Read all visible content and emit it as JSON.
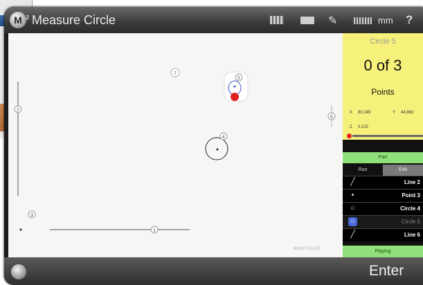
{
  "app": {
    "title": "Measure Circle",
    "units": "mm",
    "help": "?",
    "logo": "M",
    "logo_sup": "2"
  },
  "toolbar_icons": [
    "grid-icon",
    "card-icon",
    "probe-icon",
    "ruler-icon"
  ],
  "canvas": {
    "feature_labels": [
      "1",
      "2",
      "3",
      "4",
      "5",
      "6",
      "7"
    ],
    "watermark": "BOXY-U3-120"
  },
  "panel": {
    "feature_title": "Circle 5",
    "point_count": "0 of 3",
    "points_label": "Points",
    "coords": {
      "x_label": "X",
      "x_value": "80.249",
      "y_label": "Y",
      "y_value": "44.963",
      "z_label": "Z",
      "z_value": "0.102"
    },
    "part_button": "Part",
    "tabs": [
      "Run",
      "Edit"
    ],
    "features": [
      {
        "icon": "line-icon",
        "label": "Line 2"
      },
      {
        "icon": "point-icon",
        "label": "Point 3"
      },
      {
        "icon": "circle-icon",
        "label": "Circle 4"
      },
      {
        "icon": "circle-icon",
        "label": "Circle 5",
        "selected": true
      },
      {
        "icon": "line-icon",
        "label": "Line 6"
      }
    ],
    "status": "Playing"
  },
  "bottom": {
    "enter_label": "Enter"
  },
  "colors": {
    "panel_yellow": "#f6f17a",
    "status_green": "#8fe07a",
    "selected_blue": "#4a6ad8",
    "probe_red": "#e02020"
  }
}
